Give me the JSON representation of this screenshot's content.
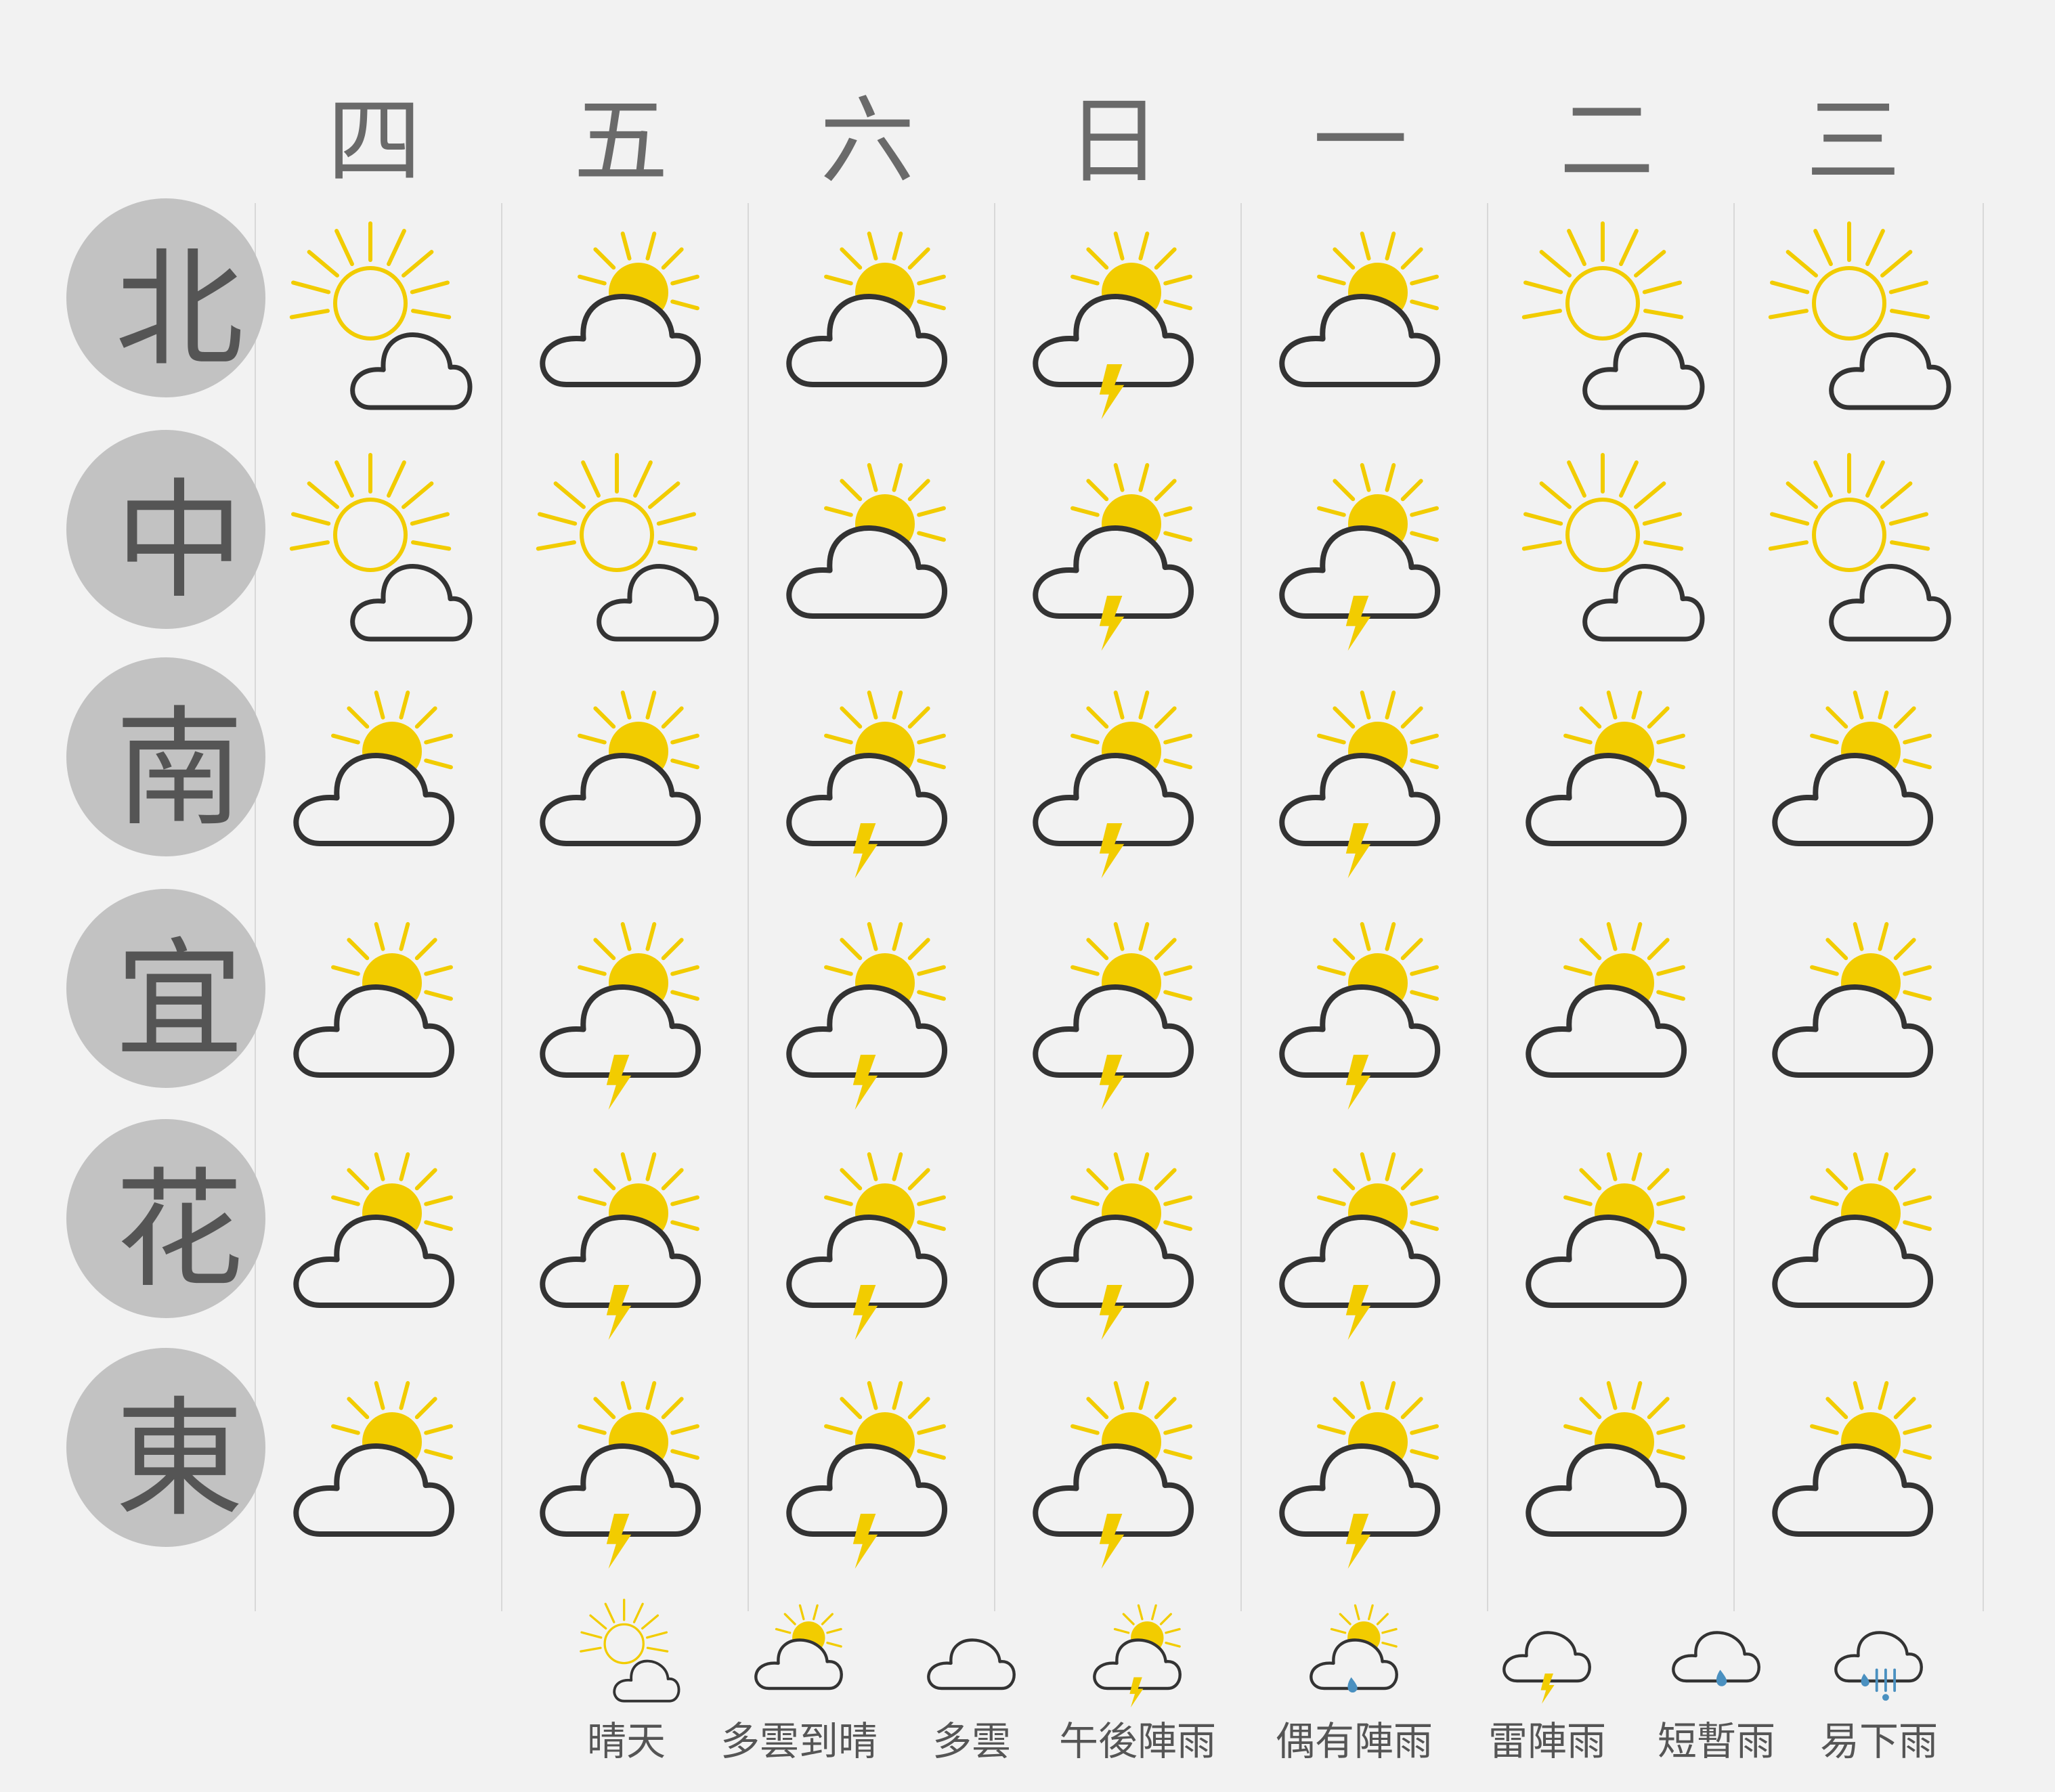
{
  "days": [
    "四",
    "五",
    "六",
    "日",
    "一",
    "二",
    "三"
  ],
  "regions": [
    "北",
    "中",
    "南",
    "宜",
    "花",
    "東"
  ],
  "forecast": [
    [
      "sunny",
      "cloudy-sunny",
      "cloudy-sunny",
      "afternoon-thunder",
      "cloudy-sunny",
      "sunny",
      "sunny"
    ],
    [
      "sunny",
      "sunny",
      "cloudy-sunny",
      "afternoon-thunder",
      "afternoon-thunder",
      "sunny",
      "sunny"
    ],
    [
      "cloudy-sunny",
      "cloudy-sunny",
      "afternoon-thunder",
      "afternoon-thunder",
      "afternoon-thunder",
      "cloudy-sunny",
      "cloudy-sunny"
    ],
    [
      "cloudy-sunny",
      "afternoon-thunder",
      "afternoon-thunder",
      "afternoon-thunder",
      "afternoon-thunder",
      "cloudy-sunny",
      "cloudy-sunny"
    ],
    [
      "cloudy-sunny",
      "afternoon-thunder",
      "afternoon-thunder",
      "afternoon-thunder",
      "afternoon-thunder",
      "cloudy-sunny",
      "cloudy-sunny"
    ],
    [
      "cloudy-sunny",
      "afternoon-thunder",
      "afternoon-thunder",
      "afternoon-thunder",
      "afternoon-thunder",
      "cloudy-sunny",
      "cloudy-sunny"
    ]
  ],
  "legend": [
    {
      "icon": "sunny",
      "label": "晴天"
    },
    {
      "icon": "cloudy-sunny",
      "label": "多雲到晴"
    },
    {
      "icon": "cloudy",
      "label": "多雲"
    },
    {
      "icon": "afternoon-thunder",
      "label": "午後陣雨"
    },
    {
      "icon": "occasional-rain",
      "label": "偶有陣雨"
    },
    {
      "icon": "thunder-shower",
      "label": "雷陣雨"
    },
    {
      "icon": "brief-rain",
      "label": "短暫雨"
    },
    {
      "icon": "rain",
      "label": "易下雨"
    }
  ],
  "colors": {
    "sun": "#f2cc00",
    "outline": "#333333",
    "rain": "#4a90c0",
    "region_bg": "#c2c2c2",
    "text": "#6a6a6a"
  }
}
